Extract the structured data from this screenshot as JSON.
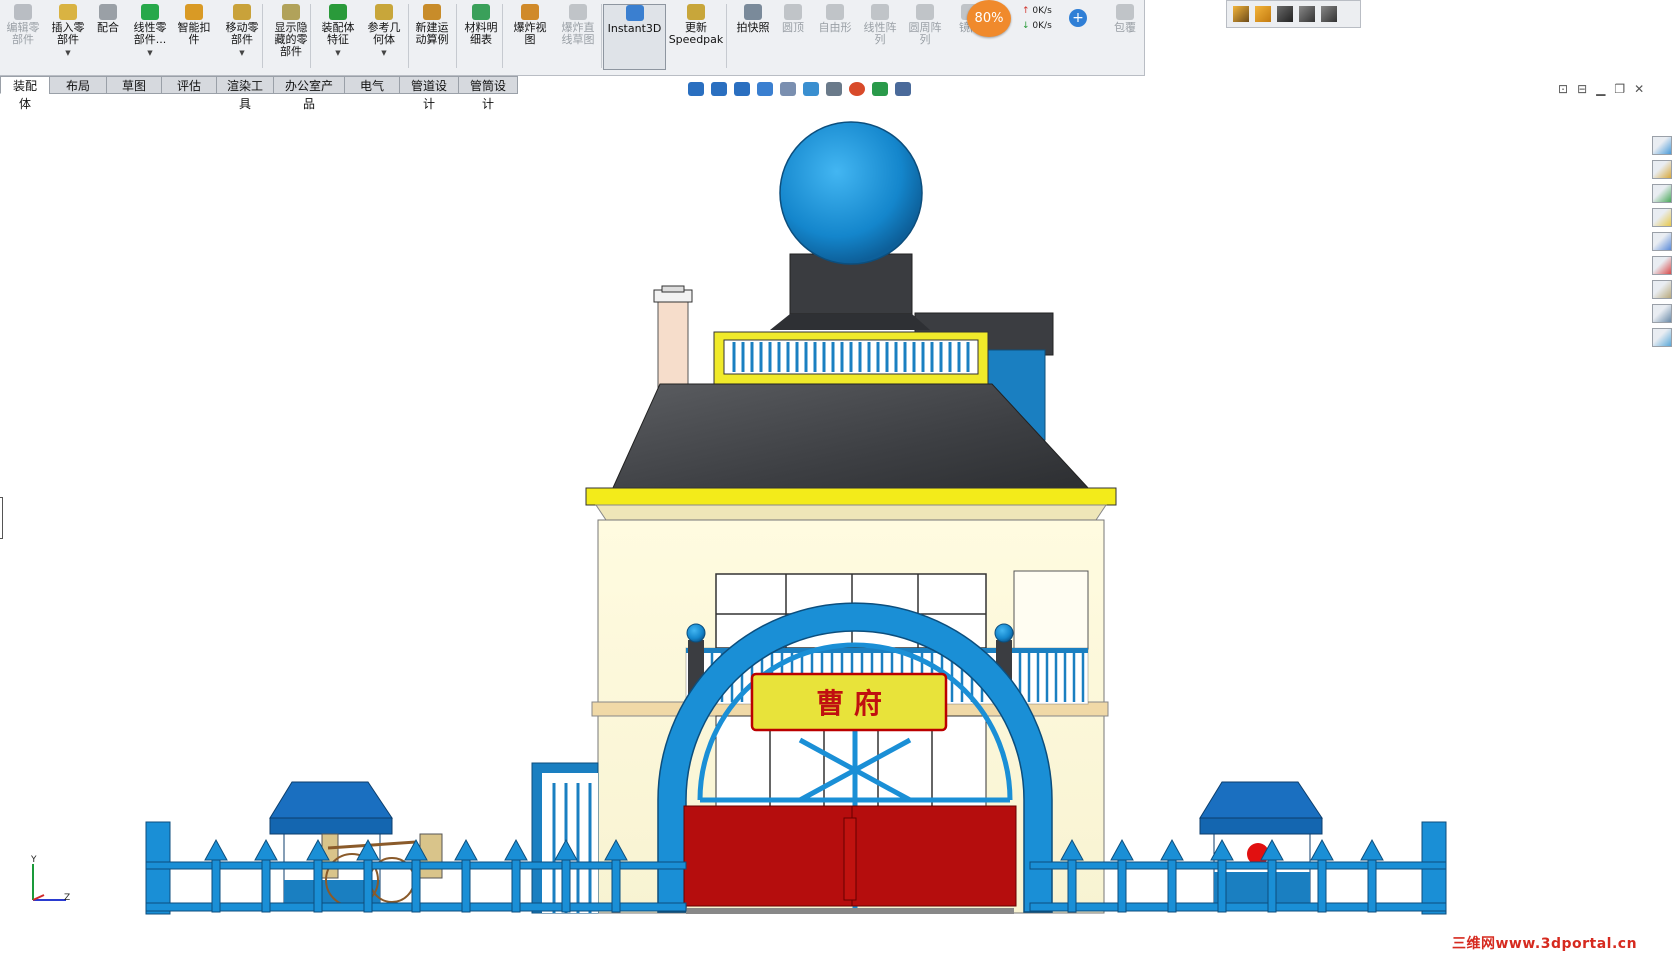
{
  "ribbon": {
    "buttons": [
      {
        "label": "编辑零\n部件",
        "icon": "edit-component-icon",
        "enabled": false
      },
      {
        "label": "插入零\n部件",
        "icon": "insert-component-icon",
        "enabled": true,
        "dropdown": true
      },
      {
        "label": "配合",
        "icon": "mate-icon",
        "enabled": true
      },
      {
        "label": "线性零\n部件...",
        "icon": "linear-pattern-icon",
        "enabled": true,
        "dropdown": true
      },
      {
        "label": "智能扣\n件",
        "icon": "smart-fastener-icon",
        "enabled": true
      },
      {
        "label": "移动零\n部件",
        "icon": "move-component-icon",
        "enabled": true,
        "dropdown": true
      },
      {
        "label": "显示隐\n藏的零\n部件",
        "icon": "show-hidden-icon",
        "enabled": true
      },
      {
        "label": "装配体\n特征",
        "icon": "assembly-feature-icon",
        "enabled": true,
        "dropdown": true
      },
      {
        "label": "参考几\n何体",
        "icon": "reference-geometry-icon",
        "enabled": true,
        "dropdown": true
      },
      {
        "label": "新建运\n动算例",
        "icon": "motion-study-icon",
        "enabled": true
      },
      {
        "label": "材料明\n细表",
        "icon": "bom-icon",
        "enabled": true
      },
      {
        "label": "爆炸视\n图",
        "icon": "exploded-view-icon",
        "enabled": true
      },
      {
        "label": "爆炸直\n线草图",
        "icon": "explode-line-icon",
        "enabled": false
      },
      {
        "label": "Instant3D",
        "icon": "instant3d-icon",
        "enabled": true,
        "active": true
      },
      {
        "label": "更新\nSpeedpak",
        "icon": "speedpak-icon",
        "enabled": true
      },
      {
        "label": "拍快照",
        "icon": "snapshot-icon",
        "enabled": true
      },
      {
        "label": "圆顶",
        "icon": "dome-icon",
        "enabled": false
      },
      {
        "label": "自由形",
        "icon": "freeform-icon",
        "enabled": false
      },
      {
        "label": "线性阵\n列",
        "icon": "linear-array-icon",
        "enabled": false
      },
      {
        "label": "圆周阵\n列",
        "icon": "circular-array-icon",
        "enabled": false
      },
      {
        "label": "镜向",
        "icon": "mirror-icon",
        "enabled": false
      },
      {
        "label": "包覆",
        "icon": "wrap-icon",
        "enabled": false
      }
    ]
  },
  "tabs": [
    "装配体",
    "布局",
    "草图",
    "评估",
    "渲染工具",
    "办公室产品",
    "电气",
    "管道设计",
    "管筒设计"
  ],
  "selected_tab": "装配体",
  "speed_meter": {
    "percent": "80%",
    "upload": "0K/s",
    "download": "0K/s"
  },
  "heads_up_icons": [
    "zoom-to-fit-icon",
    "zoom-area-icon",
    "previous-view-icon",
    "section-view-icon",
    "view-orientation-icon",
    "display-style-icon",
    "hide-show-icon",
    "edit-appearance-icon",
    "apply-scene-icon",
    "view-settings-icon"
  ],
  "task_pane_icons": [
    "resources-icon",
    "design-library-icon",
    "file-explorer-icon",
    "folder-icon",
    "view-palette-icon",
    "appearances-icon",
    "custom-properties-icon",
    "toolbox-icon",
    "forum-icon"
  ],
  "model": {
    "sign_text": "曹 府"
  },
  "triad": {
    "y_label": "Y",
    "z_label": "Z"
  },
  "watermark": "三维网www.3dportal.cn",
  "colors": {
    "accent_blue": "#1a8fd6",
    "gate_red": "#b50d0d",
    "sign_yellow": "#e8e33a",
    "roof_gray": "#45474b"
  }
}
